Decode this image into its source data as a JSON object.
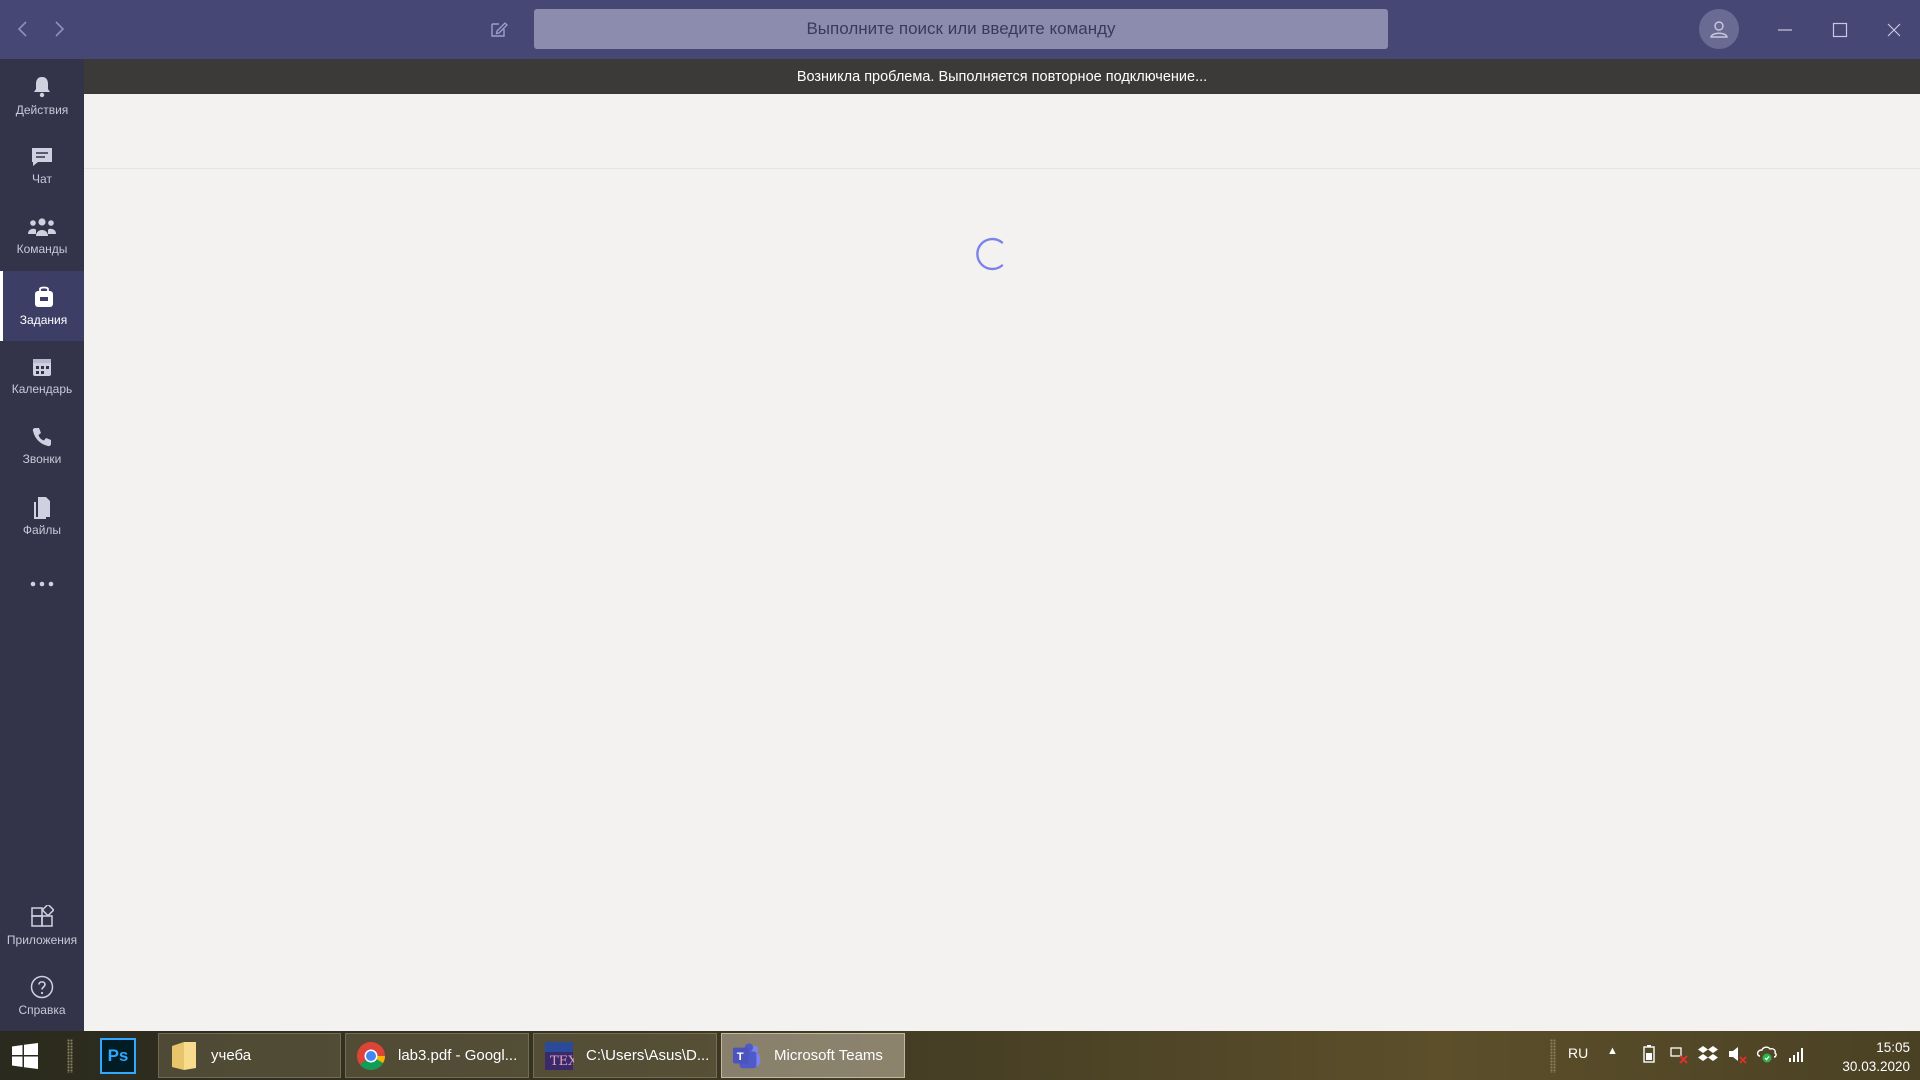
{
  "titlebar": {
    "search_placeholder": "Выполните поиск или введите команду",
    "icons": {
      "back": "chevron-left-icon",
      "forward": "chevron-right-icon",
      "compose": "compose-icon",
      "avatar": "user-avatar-icon",
      "minimize": "minimize-icon",
      "maximize": "maximize-icon",
      "close": "close-icon"
    }
  },
  "rail": {
    "items": [
      {
        "label": "Действия",
        "icon": "bell-icon",
        "active": false
      },
      {
        "label": "Чат",
        "icon": "chat-icon",
        "active": false
      },
      {
        "label": "Команды",
        "icon": "teams-icon",
        "active": false
      },
      {
        "label": "Задания",
        "icon": "assignments-icon",
        "active": true
      },
      {
        "label": "Календарь",
        "icon": "calendar-icon",
        "active": false
      },
      {
        "label": "Звонки",
        "icon": "phone-icon",
        "active": false
      },
      {
        "label": "Файлы",
        "icon": "files-icon",
        "active": false
      },
      {
        "label": "",
        "icon": "more-icon",
        "active": false
      }
    ],
    "bottom_items": [
      {
        "label": "Приложения",
        "icon": "apps-icon"
      },
      {
        "label": "Справка",
        "icon": "help-icon"
      }
    ]
  },
  "banner": {
    "message": "Возникла проблема. Выполняется повторное подключение..."
  },
  "main": {
    "state": "loading"
  },
  "taskbar": {
    "tasks": [
      {
        "label": "учеба",
        "icon": "folder-icon",
        "active": false
      },
      {
        "label": "lab3.pdf - Googl...",
        "icon": "chrome-icon",
        "active": false
      },
      {
        "label": "C:\\Users\\Asus\\D...",
        "icon": "tex-icon",
        "active": false
      },
      {
        "label": "Microsoft Teams",
        "icon": "teams-app-icon",
        "active": true
      }
    ],
    "ps_label": "Ps",
    "tray": {
      "language": "RU",
      "time": "15:05",
      "date": "30.03.2020"
    }
  },
  "colors": {
    "titlebar": "#464775",
    "rail": "#33344a",
    "banner": "#3b3a39",
    "main": "#f3f2f1",
    "accent": "#7b83eb"
  }
}
